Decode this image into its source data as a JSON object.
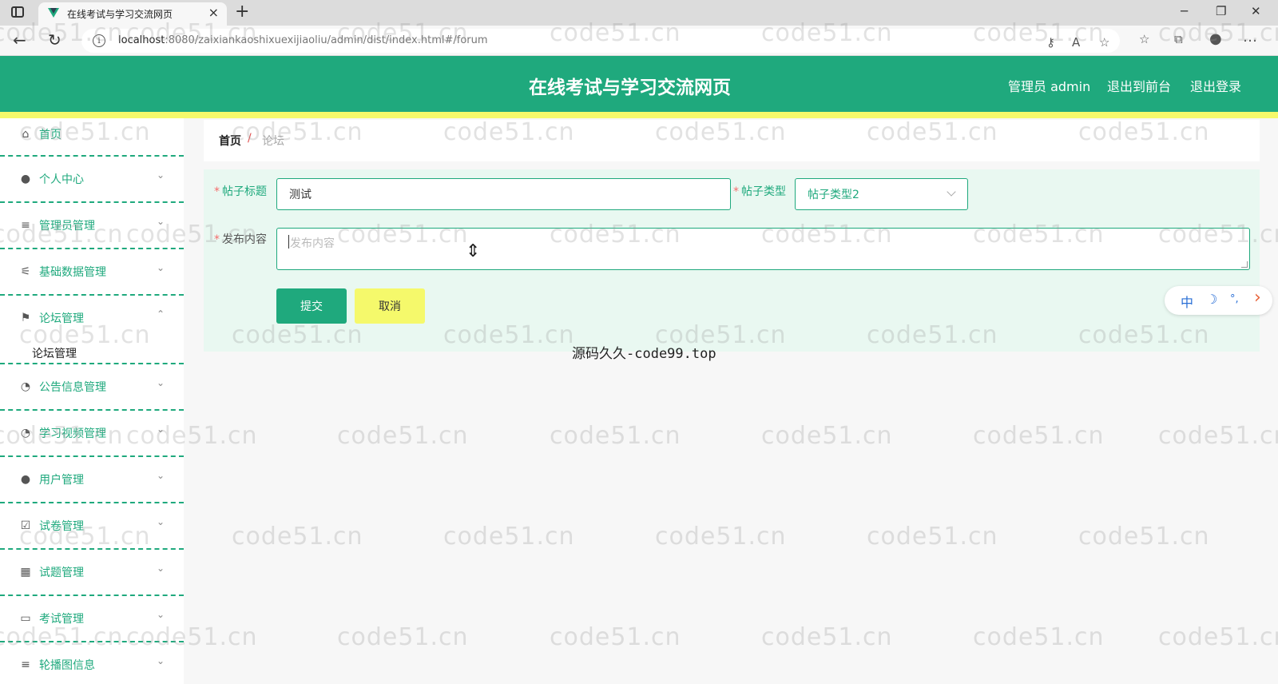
{
  "browser": {
    "tab_title": "在线考试与学习交流网页",
    "url_host": "localhost",
    "url_rest": ":8080/zaixiankaoshixuexijiaoliu/admin/dist/index.html#/forum"
  },
  "header": {
    "title": "在线考试与学习交流网页",
    "user": "管理员 admin",
    "to_front": "退出到前台",
    "logout": "退出登录"
  },
  "sidebar": {
    "items": [
      {
        "label": "首页",
        "icon": "home-icon"
      },
      {
        "label": "个人中心",
        "icon": "user-icon"
      },
      {
        "label": "管理员管理",
        "icon": "list-icon"
      },
      {
        "label": "基础数据管理",
        "icon": "sliders-icon"
      },
      {
        "label": "论坛管理",
        "icon": "flag-icon",
        "sub": "论坛管理"
      },
      {
        "label": "公告信息管理",
        "icon": "compass-icon"
      },
      {
        "label": "学习视频管理",
        "icon": "compass-icon"
      },
      {
        "label": "用户管理",
        "icon": "user-icon"
      },
      {
        "label": "试卷管理",
        "icon": "checkbox-icon"
      },
      {
        "label": "试题管理",
        "icon": "grid-icon"
      },
      {
        "label": "考试管理",
        "icon": "monitor-icon"
      },
      {
        "label": "轮播图信息",
        "icon": "list-icon"
      }
    ]
  },
  "breadcrumb": {
    "home": "首页",
    "sep": "/",
    "current": "论坛"
  },
  "form": {
    "title_label": "帖子标题",
    "title_value": "测试",
    "type_label": "帖子类型",
    "type_value": "帖子类型2",
    "content_label": "发布内容",
    "content_placeholder": "发布内容",
    "required_mark": "*",
    "submit": "提交",
    "cancel": "取消"
  },
  "footer_text": "源码久久-code99.top",
  "float_toolbar": {
    "lang": "中",
    "moon": "☽",
    "punct": "°,",
    "arrow": "›"
  },
  "watermark": "code51.cn",
  "colors": {
    "primary": "#1fa97d",
    "accent_yellow": "#f5f96b",
    "panel_bg": "#e9f8f1"
  }
}
